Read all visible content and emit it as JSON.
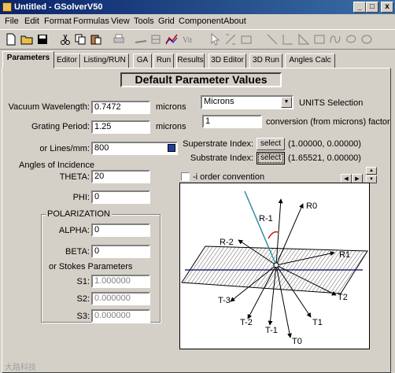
{
  "window": {
    "title": "Untitled - GSolverV50",
    "min": "_",
    "max": "□",
    "close": "x"
  },
  "menu": [
    "File",
    "Edit",
    "Format",
    "Formulas",
    "View",
    "Tools",
    "Grid",
    "Component",
    "About"
  ],
  "tabs": [
    "Parameters",
    "Editor",
    "Listing/RUN",
    "GA",
    "Run",
    "Results",
    "3D Editor",
    "3D Run",
    "Angles Calc"
  ],
  "heading": "Default Parameter Values",
  "wavelength": {
    "label": "Vacuum Wavelength:",
    "value": "0.7472",
    "unit": "microns"
  },
  "period": {
    "label": "Grating Period:",
    "value": "1.25",
    "unit": "microns"
  },
  "lines": {
    "label": "or Lines/mm:",
    "value": "800"
  },
  "angles": {
    "label": "Angles of Incidence",
    "theta_label": "THETA:",
    "theta": "20",
    "phi_label": "PHI:",
    "phi": "0"
  },
  "polarization": {
    "title": "POLARIZATION",
    "alpha_label": "ALPHA:",
    "alpha": "0",
    "beta_label": "BETA:",
    "beta": "0",
    "stokes_label": "or Stokes Parameters",
    "s1_label": "S1:",
    "s1": "1.000000",
    "s2_label": "S2:",
    "s2": "0.000000",
    "s3_label": "S3:",
    "s3": "0.000000"
  },
  "units": {
    "selected": "Microns",
    "label": "UNITS Selection",
    "factor": "1",
    "factor_label": "conversion (from microns) factor"
  },
  "superstrate": {
    "label": "Superstrate Index:",
    "button": "select",
    "value": "(1.00000, 0.00000)"
  },
  "substrate": {
    "label": "Substrate Index:",
    "button": "select",
    "value": "(1.65521, 0.00000)"
  },
  "order_convention": "-i order convention",
  "diagram_labels": {
    "r1m": "R-1",
    "r0": "R0",
    "r2m": "R-2",
    "r1": "R1",
    "t3m": "T-3",
    "t2": "T2",
    "t2m": "T-2",
    "t1": "T1",
    "t1m": "T-1",
    "t0": "T0"
  },
  "watermark": "大路科技"
}
